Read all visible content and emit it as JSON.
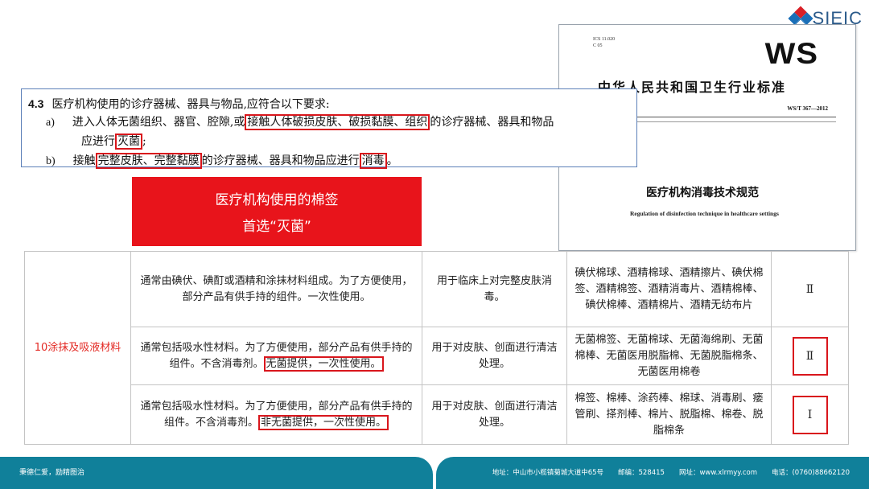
{
  "logo": {
    "text": "SIEIC"
  },
  "standard": {
    "ics": "ICS 11.020",
    "ccs": "C 05",
    "badge": "WS",
    "title": "中华人民共和国卫生行业标准",
    "number": "WS/T 367—2012",
    "cn_name": "医疗机构消毒技术规范",
    "en_name": "Regulation of disinfection technique in healthcare settings"
  },
  "clause": {
    "number": "4.3",
    "intro": "医疗机构使用的诊疗器械、器具与物品,应符合以下要求:",
    "a_marker": "a)",
    "a_part1": "进入人体无菌组织、器官、腔隙,或",
    "a_hl1": "接触人体破损皮肤、破损黏膜、组织",
    "a_part2": "的诊疗器械、器具和物品",
    "a_cont": "应进行",
    "a_hl2": "灭菌",
    "a_end": ";",
    "b_marker": "b)",
    "b_part1": "接触",
    "b_hl1": "完整皮肤、完整黏膜",
    "b_part2": "的诊疗器械、器具和物品应进行",
    "b_hl2": "消毒",
    "b_end": "。"
  },
  "callout": {
    "line1": "医疗机构使用的棉签",
    "line2": "首选“灭菌”"
  },
  "table": {
    "category": "10涂抹及吸液材料",
    "rows": [
      {
        "desc": "通常由碘伏、碘酊或酒精和涂抹材料组成。为了方便使用，部分产品有供手持的组件。一次性使用。",
        "desc_hl": "",
        "use": "用于临床上对完整皮肤消毒。",
        "examples": "碘伏棉球、酒精棉球、酒精擦片、碘伏棉签、酒精棉签、酒精消毒片、酒精棉棒、碘伏棉棒、酒精棉片、酒精无纺布片",
        "class": "Ⅱ"
      },
      {
        "desc": "通常包括吸水性材料。为了方便使用，部分产品有供手持的组件。不含消毒剂。",
        "desc_hl": "无菌提供，一次性使用。",
        "use": "用于对皮肤、创面进行清洁处理。",
        "examples": "无菌棉签、无菌棉球、无菌海绵刷、无菌棉棒、无菌医用脱脂棉、无菌脱脂棉条、无菌医用棉卷",
        "class": "Ⅱ"
      },
      {
        "desc": "通常包括吸水性材料。为了方便使用，部分产品有供手持的组件。不含消毒剂。",
        "desc_hl": "非无菌提供，一次性使用。",
        "use": "用于对皮肤、创面进行清洁处理。",
        "examples": "棉签、棉棒、涂药棒、棉球、消毒刷、瘘管刷、搽剂棒、棉片、脱脂棉、棉卷、脱脂棉条",
        "class": "Ⅰ"
      }
    ]
  },
  "footer": {
    "slogan": "秉德仁爱，励精图治",
    "address": "地址：中山市小榄镇菊城大道中65号",
    "postcode": "邮编：528415",
    "website": "网址：www.xlrmyy.com",
    "phone": "电话：(0760)88662120"
  },
  "colors": {
    "accent_red": "#e8141b",
    "footer_teal": "#10809a",
    "clause_border": "#5b7fb8"
  }
}
